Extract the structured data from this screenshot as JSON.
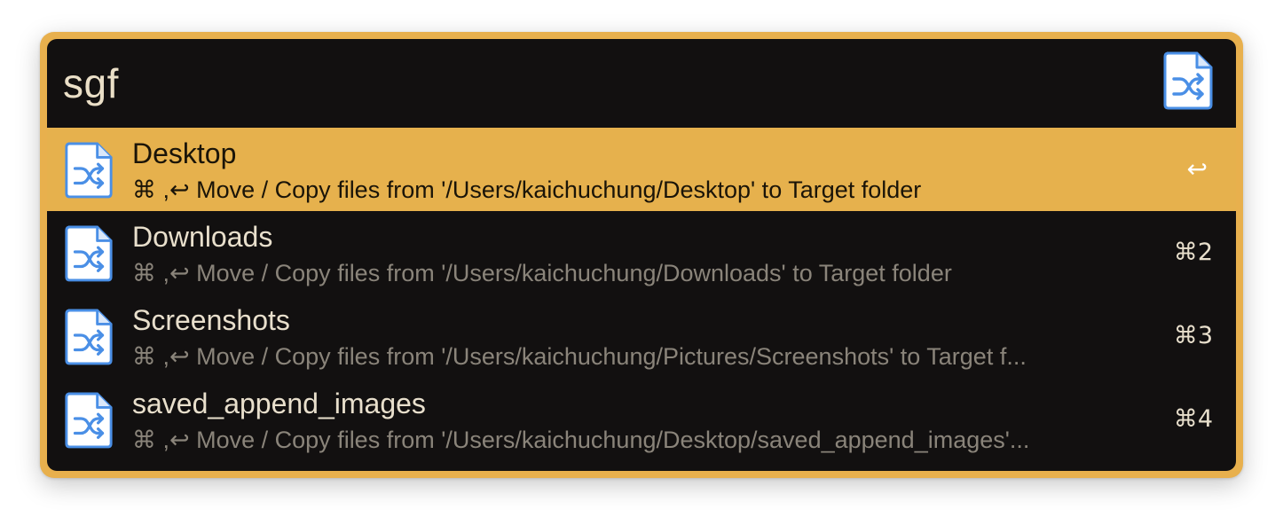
{
  "search": {
    "query": "sgf"
  },
  "workflow_icon": "shuffle-file-icon",
  "colors": {
    "accent": "#e6b14d",
    "background": "#121010",
    "icon_blue": "#4a8fe6"
  },
  "results": [
    {
      "title": "Desktop",
      "subtitle": "⌘ ,↩ Move / Copy files from '/Users/kaichuchung/Desktop' to Target folder",
      "shortcut": "↩",
      "selected": true
    },
    {
      "title": "Downloads",
      "subtitle": "⌘ ,↩ Move / Copy files from '/Users/kaichuchung/Downloads' to Target folder",
      "shortcut": "⌘2",
      "selected": false
    },
    {
      "title": "Screenshots",
      "subtitle": "⌘ ,↩ Move / Copy files from '/Users/kaichuchung/Pictures/Screenshots' to Target f...",
      "shortcut": "⌘3",
      "selected": false
    },
    {
      "title": "saved_append_images",
      "subtitle": "⌘ ,↩ Move / Copy files from '/Users/kaichuchung/Desktop/saved_append_images'...",
      "shortcut": "⌘4",
      "selected": false
    }
  ]
}
